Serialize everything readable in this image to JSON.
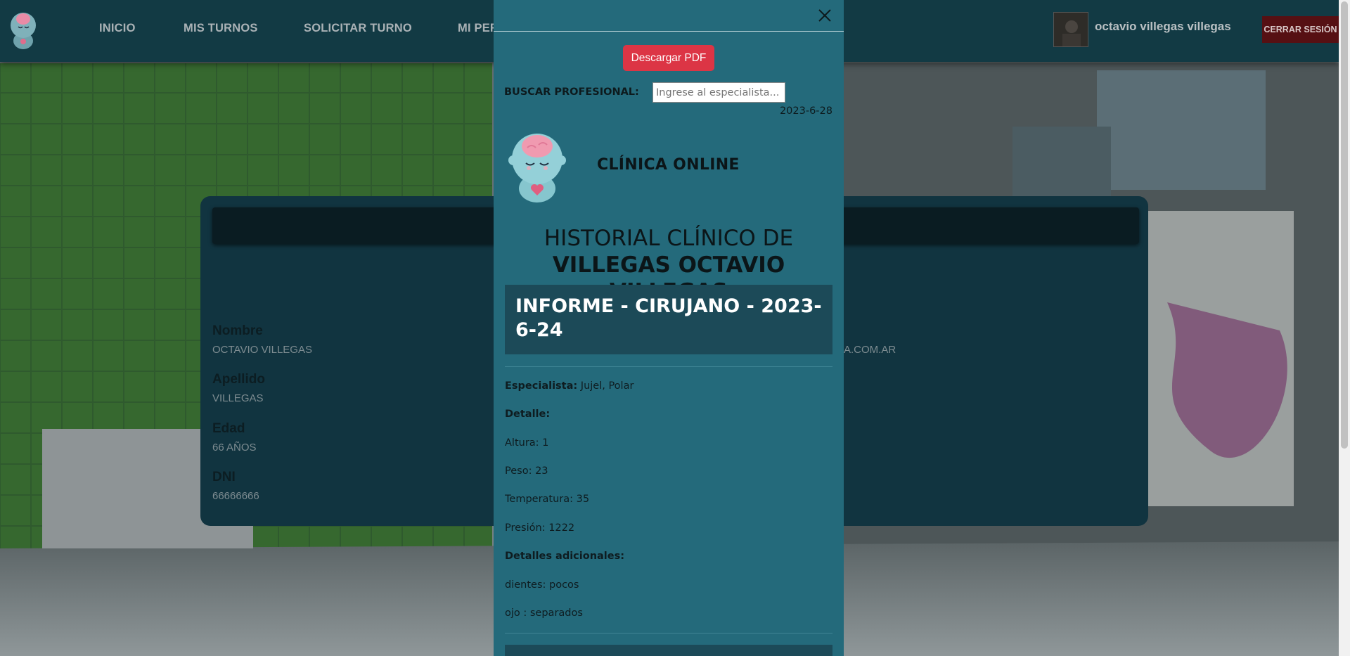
{
  "navbar": {
    "links": [
      "INICIO",
      "MIS TURNOS",
      "SOLICITAR TURNO",
      "MI PER"
    ],
    "user_name": "octavio villegas villegas",
    "logout_label": "CERRAR SESIÓN"
  },
  "profile": {
    "fields": [
      {
        "label": "Nombre",
        "value": "OCTAVIO VILLEGAS"
      },
      {
        "label": "Apellido",
        "value": "VILLEGAS"
      },
      {
        "label": "Edad",
        "value": "66 AÑOS"
      },
      {
        "label": "DNI",
        "value": "66666666"
      }
    ],
    "email_partial": "A.COM.AR"
  },
  "modal": {
    "pdf_button": "Descargar PDF",
    "search_label": "BUSCAR PROFESIONAL:",
    "search_placeholder": "Ingrese al especialista...",
    "date": "2023-6-28",
    "clinic_name": "CLÍNICA ONLINE",
    "history_title": "HISTORIAL CLÍNICO DE",
    "patient_name": "VILLEGAS OCTAVIO VILLEGAS",
    "report": {
      "prefix": "INFORME - ",
      "specialty": "CIRUJANO",
      "suffix": " - 2023-6-24",
      "specialist_label": "Especialista:",
      "specialist_value": " Jujel, Polar",
      "detail_label": "Detalle:",
      "altura": "Altura: 1",
      "peso": "Peso: 23",
      "temperatura": "Temperatura: 35",
      "presion": "Presión: 1222",
      "additional_label": "Detalles adicionales:",
      "extra1": "dientes: pocos",
      "extra2": "ojo : separados"
    }
  },
  "colors": {
    "navbar_bg": "#123a44",
    "modal_bg": "#246a7b",
    "pdf_button": "#dc3545",
    "logout_button": "#561013"
  }
}
